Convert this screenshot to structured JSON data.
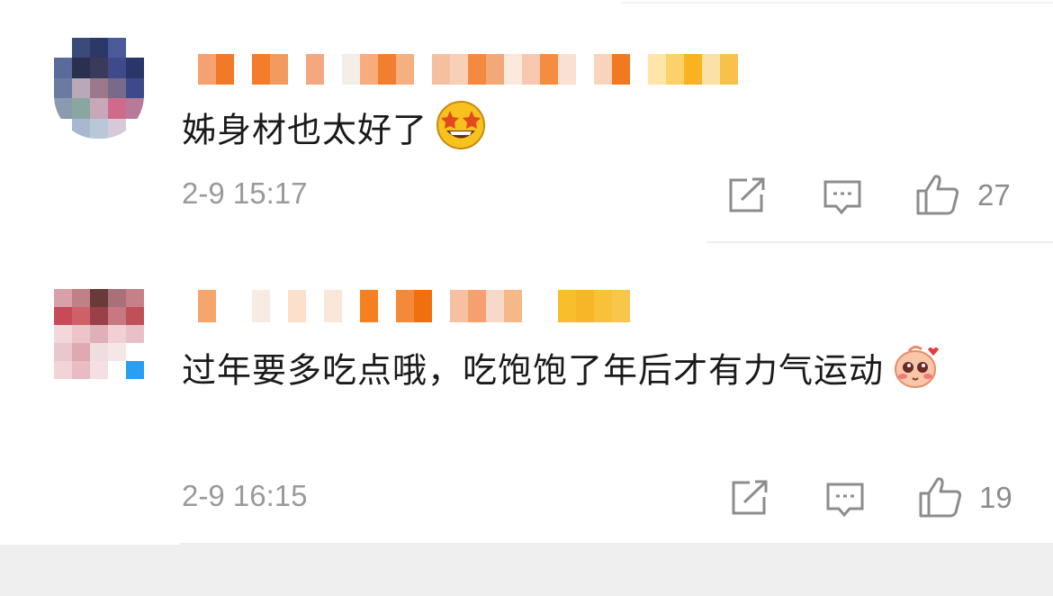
{
  "comments": [
    {
      "text": "姊身材也太好了",
      "emoji": "star-struck-emoji",
      "timestamp": "2-9 15:17",
      "likes": "27"
    },
    {
      "text": "过年要多吃点哦，吃饱饱了年后才有力气运动",
      "emoji": "blushing-sticker-emoji",
      "timestamp": "2-9 16:15",
      "likes": "19"
    }
  ],
  "icons": {
    "share": "share-icon",
    "reply": "comment-icon",
    "like": "thumbs-up-icon"
  },
  "colors": {
    "text": "#1a1a1a",
    "meta": "#9a9a9a",
    "background": "#ffffff",
    "footer": "#efefef"
  }
}
